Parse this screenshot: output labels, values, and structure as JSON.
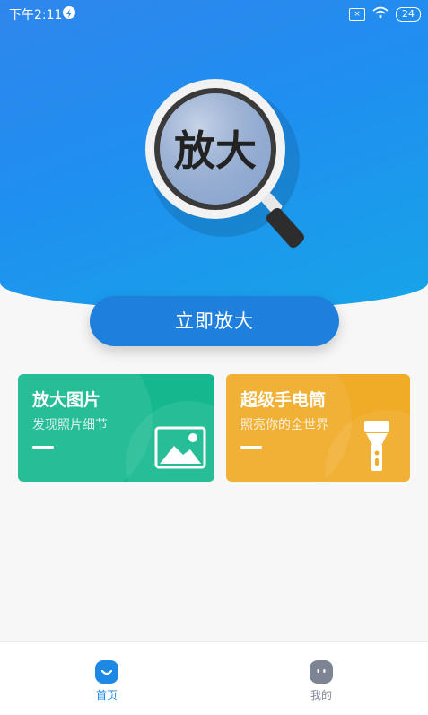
{
  "status_bar": {
    "time": "下午2:11",
    "sim_icon": "sim-off-icon",
    "battery_level": "24"
  },
  "hero": {
    "magnifier_text": "放大",
    "cta_label": "立即放大"
  },
  "cards": [
    {
      "title": "放大图片",
      "subtitle": "发现照片细节",
      "icon": "image-icon",
      "color": "#15b88e"
    },
    {
      "title": "超级手电筒",
      "subtitle": "照亮你的全世界",
      "icon": "flashlight-icon",
      "color": "#f0ab27"
    }
  ],
  "tabbar": {
    "items": [
      {
        "label": "首页",
        "icon": "home-face-icon",
        "active": true,
        "color": "#1e88e5"
      },
      {
        "label": "我的",
        "icon": "mine-face-icon",
        "active": false,
        "color": "#7d8494"
      }
    ]
  }
}
